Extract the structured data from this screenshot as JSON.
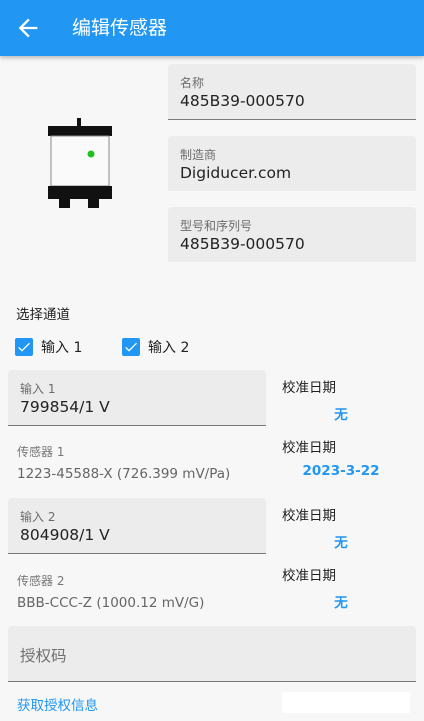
{
  "appbar": {
    "title": "编辑传感器",
    "back_icon": "arrow-left-icon"
  },
  "sensor": {
    "name_label": "名称",
    "name_value": "485B39-000570",
    "manufacturer_label": "制造商",
    "manufacturer_value": "Digiducer.com",
    "model_label": "型号和序列号",
    "model_value": "485B39-000570"
  },
  "channels": {
    "section_label": "选择通道",
    "options": [
      {
        "label": "输入 1",
        "checked": true
      },
      {
        "label": "输入 2",
        "checked": true
      }
    ],
    "input1": {
      "field_label": "输入 1",
      "field_value": "799854/1 V",
      "sensor_label": "传感器 1",
      "sensor_value": "1223-45588-X (726.399 mV/Pa)",
      "cal1_label": "校准日期",
      "cal1_value": "无",
      "cal2_label": "校准日期",
      "cal2_value": "2023-3-22"
    },
    "input2": {
      "field_label": "输入 2",
      "field_value": "804908/1 V",
      "sensor_label": "传感器 2",
      "sensor_value": "BBB-CCC-Z (1000.12 mV/G)",
      "cal1_label": "校准日期",
      "cal1_value": "无",
      "cal2_label": "校准日期",
      "cal2_value": "无"
    }
  },
  "auth": {
    "placeholder": "授权码",
    "link": "获取授权信息"
  },
  "colors": {
    "primary": "#2196f3",
    "background": "#f7f7f7",
    "field_bg": "#ececec"
  }
}
